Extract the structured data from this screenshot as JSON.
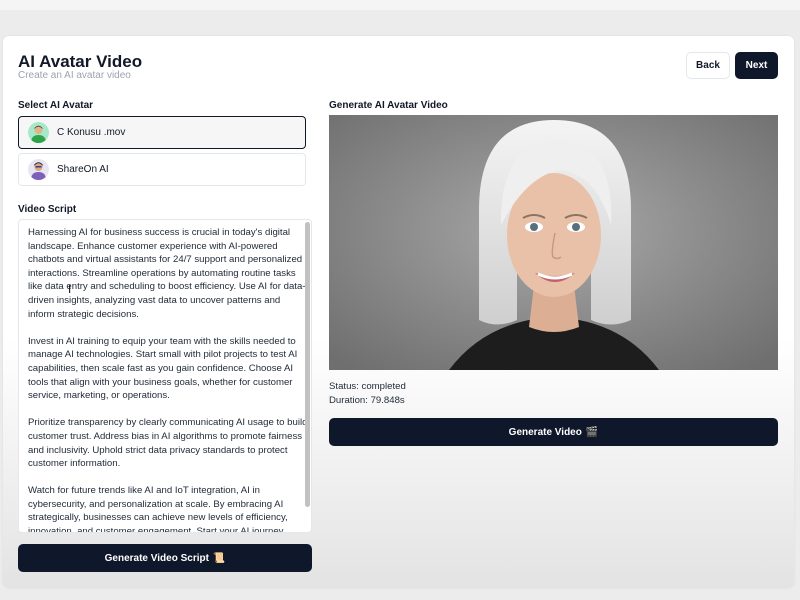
{
  "header": {
    "title": "AI Avatar Video",
    "subtitle": "Create an AI avatar video",
    "back_label": "Back",
    "next_label": "Next"
  },
  "avatar_section": {
    "label": "Select AI Avatar",
    "items": [
      {
        "name": "C Konusu .mov",
        "selected": true
      },
      {
        "name": "ShareOn AI",
        "selected": false
      }
    ]
  },
  "script_section": {
    "label": "Video Script",
    "paragraphs": [
      "Harnessing AI for business success is crucial in today's digital landscape. Enhance customer experience with AI-powered chatbots and virtual assistants for 24/7 support and personalized interactions. Streamline operations by automating routine tasks like data entry and scheduling to boost efficiency. Use AI for data-driven insights, analyzing vast data to uncover patterns and inform strategic decisions.",
      "Invest in AI training to equip your team with the skills needed to manage AI technologies. Start small with pilot projects to test AI capabilities, then scale fast as you gain confidence. Choose AI tools that align with your business goals, whether for customer service, marketing, or operations.",
      "Prioritize transparency by clearly communicating AI usage to build customer trust. Address bias in AI algorithms to promote fairness and inclusivity. Uphold strict data privacy standards to protect customer information.",
      "Watch for future trends like AI and IoT integration, AI in cybersecurity, and personalization at scale. By embracing AI strategically, businesses can achieve new levels of efficiency, innovation, and customer engagement. Start your AI journey today!"
    ],
    "generate_label": "Generate Video Script",
    "generate_icon": "📜"
  },
  "video_section": {
    "label": "Generate AI Avatar Video",
    "status": "Status: completed",
    "duration": "Duration: 79.848s",
    "generate_label": "Generate Video",
    "generate_icon": "🎬"
  },
  "colors": {
    "primary": "#0f172a",
    "border": "#e5e7eb",
    "muted_text": "#9ca3af"
  }
}
